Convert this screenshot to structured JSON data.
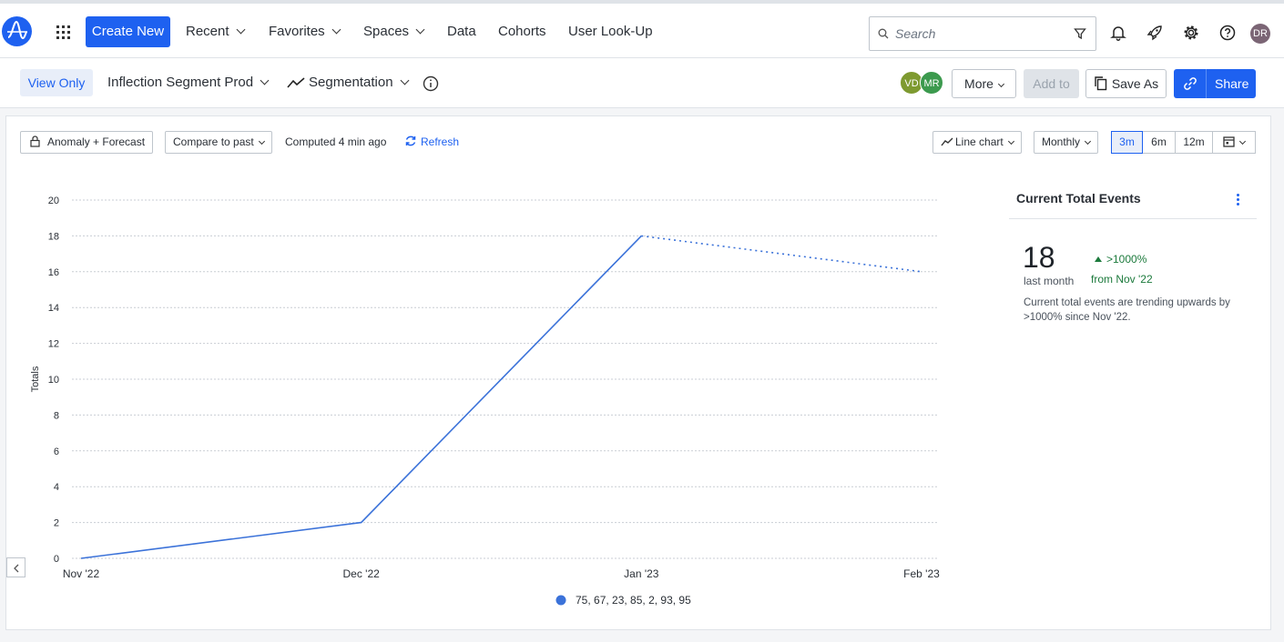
{
  "nav": {
    "create_new": "Create New",
    "recent": "Recent",
    "favorites": "Favorites",
    "spaces": "Spaces",
    "data": "Data",
    "cohorts": "Cohorts",
    "user_lookup": "User Look-Up",
    "search_placeholder": "Search",
    "user_initials": "DR"
  },
  "subbar": {
    "view_only": "View Only",
    "chart_name": "Inflection Segment Prod",
    "chart_type": "Segmentation",
    "viewers": [
      "VD",
      "MR"
    ],
    "more": "More",
    "add_to": "Add to",
    "save_as": "Save As",
    "share": "Share"
  },
  "controls": {
    "anomaly": "Anomaly + Forecast",
    "compare": "Compare to past",
    "computed": "Computed 4 min ago",
    "refresh": "Refresh",
    "viz": "Line chart",
    "interval": "Monthly",
    "ranges": [
      "3m",
      "6m",
      "12m"
    ],
    "active_range": "3m"
  },
  "summary": {
    "title": "Current Total Events",
    "value": "18",
    "value_sub": "last month",
    "delta": ">1000%",
    "delta_sub": "from Nov '22",
    "description": "Current total events are trending upwards by >1000% since Nov '22."
  },
  "chart_data": {
    "type": "line",
    "categories": [
      "Nov '22",
      "Dec '22",
      "Jan '23",
      "Feb '23"
    ],
    "series": [
      {
        "name": "75, 67, 23, 85, 2, 93, 95",
        "values": [
          0,
          2,
          18,
          16
        ],
        "forecast_from_index": 2,
        "color": "#3b72d9"
      }
    ],
    "ylabel": "Totals",
    "ylim": [
      0,
      20
    ],
    "yticks": [
      0,
      2,
      4,
      6,
      8,
      10,
      12,
      14,
      16,
      18,
      20
    ],
    "grid": true,
    "legend_position": "bottom"
  },
  "colors": {
    "accent": "#1e61f0",
    "positive": "#1c7a3c",
    "viewer_vd": "#7e9a30",
    "viewer_mr": "#3c9a4e"
  }
}
